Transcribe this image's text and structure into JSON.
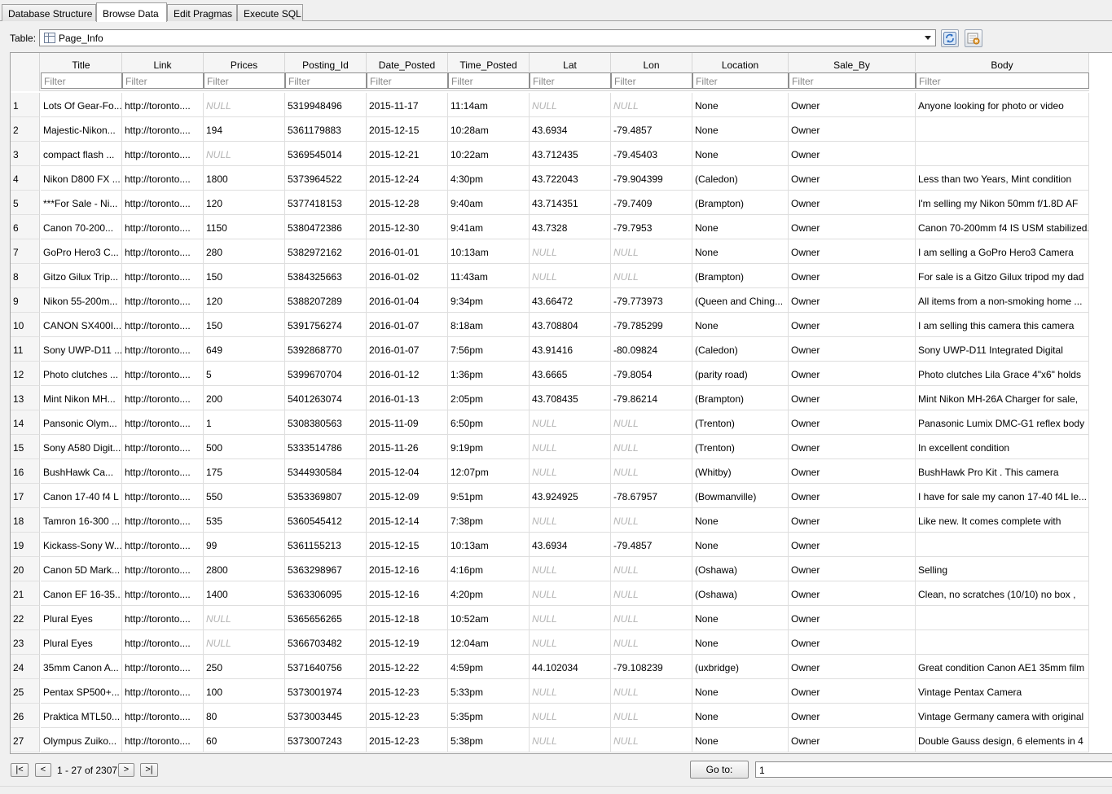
{
  "tabs": [
    {
      "label": "Database Structure"
    },
    {
      "label": "Browse Data",
      "active": true
    },
    {
      "label": "Edit Pragmas"
    },
    {
      "label": "Execute SQL"
    }
  ],
  "table_selector": {
    "label": "Table:",
    "value": "Page_Info"
  },
  "columns": [
    "Title",
    "Link",
    "Prices",
    "Posting_Id",
    "Date_Posted",
    "Time_Posted",
    "Lat",
    "Lon",
    "Location",
    "Sale_By",
    "Body"
  ],
  "filter_placeholder": "Filter",
  "rows": [
    [
      "1",
      "Lots Of Gear-Fo...",
      "http://toronto....",
      "NULL",
      "5319948496",
      "2015-11-17",
      "11:14am",
      "NULL",
      "NULL",
      "None",
      "Owner",
      "Anyone looking for photo or video"
    ],
    [
      "2",
      "Majestic-Nikon...",
      "http://toronto....",
      "194",
      "5361179883",
      "2015-12-15",
      "10:28am",
      "43.6934",
      "-79.4857",
      "None",
      "Owner",
      ""
    ],
    [
      "3",
      "compact flash ...",
      "http://toronto....",
      "NULL",
      "5369545014",
      "2015-12-21",
      "10:22am",
      "43.712435",
      "-79.45403",
      "None",
      "Owner",
      ""
    ],
    [
      "4",
      "Nikon D800 FX ...",
      "http://toronto....",
      "1800",
      "5373964522",
      "2015-12-24",
      "4:30pm",
      "43.722043",
      "-79.904399",
      " (Caledon)",
      "Owner",
      "Less than two Years, Mint condition"
    ],
    [
      "5",
      "***For Sale - Ni...",
      "http://toronto....",
      "120",
      "5377418153",
      "2015-12-28",
      "9:40am",
      "43.714351",
      "-79.7409",
      " (Brampton)",
      "Owner",
      "I'm selling my Nikon 50mm f/1.8D AF"
    ],
    [
      "6",
      "Canon 70-200...",
      "http://toronto....",
      "1150",
      "5380472386",
      "2015-12-30",
      "9:41am",
      "43.7328",
      "-79.7953",
      "None",
      "Owner",
      "Canon 70-200mm f4 IS USM stabilized."
    ],
    [
      "7",
      "GoPro Hero3 C...",
      "http://toronto....",
      "280",
      "5382972162",
      "2016-01-01",
      "10:13am",
      "NULL",
      "NULL",
      "None",
      "Owner",
      "I am selling a GoPro Hero3 Camera"
    ],
    [
      "8",
      "Gitzo Gilux Trip...",
      "http://toronto....",
      "150",
      "5384325663",
      "2016-01-02",
      "11:43am",
      "NULL",
      "NULL",
      " (Brampton)",
      "Owner",
      "For sale is a Gitzo Gilux tripod my dad"
    ],
    [
      "9",
      "Nikon 55-200m...",
      "http://toronto....",
      "120",
      "5388207289",
      "2016-01-04",
      "9:34pm",
      "43.66472",
      "-79.773973",
      " (Queen and Ching...",
      "Owner",
      "All items from a non-smoking home ..."
    ],
    [
      "10",
      "CANON SX400I...",
      "http://toronto....",
      "150",
      "5391756274",
      "2016-01-07",
      "8:18am",
      "43.708804",
      "-79.785299",
      "None",
      "Owner",
      "I am selling this camera this camera"
    ],
    [
      "11",
      "Sony UWP-D11 ...",
      "http://toronto....",
      "649",
      "5392868770",
      "2016-01-07",
      "7:56pm",
      "43.91416",
      "-80.09824",
      " (Caledon)",
      "Owner",
      "Sony UWP-D11 Integrated Digital"
    ],
    [
      "12",
      "Photo clutches ...",
      "http://toronto....",
      "5",
      "5399670704",
      "2016-01-12",
      "1:36pm",
      "43.6665",
      "-79.8054",
      " (parity road)",
      "Owner",
      "Photo clutches Lila Grace 4\"x6\" holds"
    ],
    [
      "13",
      "Mint Nikon MH...",
      "http://toronto....",
      "200",
      "5401263074",
      "2016-01-13",
      "2:05pm",
      "43.708435",
      "-79.86214",
      " (Brampton)",
      "Owner",
      "Mint Nikon MH-26A Charger for sale,"
    ],
    [
      "14",
      "Pansonic Olym...",
      "http://toronto....",
      "1",
      "5308380563",
      "2015-11-09",
      "6:50pm",
      "NULL",
      "NULL",
      " (Trenton)",
      "Owner",
      "Panasonic Lumix DMC-G1 reflex body"
    ],
    [
      "15",
      "Sony A580 Digit...",
      "http://toronto....",
      "500",
      "5333514786",
      "2015-11-26",
      "9:19pm",
      "NULL",
      "NULL",
      " (Trenton)",
      "Owner",
      "In excellent condition"
    ],
    [
      "16",
      "BushHawk Ca...",
      "http://toronto....",
      "175",
      "5344930584",
      "2015-12-04",
      "12:07pm",
      "NULL",
      "NULL",
      " (Whitby)",
      "Owner",
      "BushHawk Pro Kit . This camera"
    ],
    [
      "17",
      "Canon 17-40 f4 L",
      "http://toronto....",
      "550",
      "5353369807",
      "2015-12-09",
      "9:51pm",
      "43.924925",
      "-78.67957",
      " (Bowmanville)",
      "Owner",
      "I have for sale my canon 17-40 f4L le..."
    ],
    [
      "18",
      "Tamron 16-300 ...",
      "http://toronto....",
      "535",
      "5360545412",
      "2015-12-14",
      "7:38pm",
      "NULL",
      "NULL",
      "None",
      "Owner",
      "Like new. It comes complete with"
    ],
    [
      "19",
      "Kickass-Sony W...",
      "http://toronto....",
      "99",
      "5361155213",
      "2015-12-15",
      "10:13am",
      "43.6934",
      "-79.4857",
      "None",
      "Owner",
      ""
    ],
    [
      "20",
      "Canon 5D Mark...",
      "http://toronto....",
      "2800",
      "5363298967",
      "2015-12-16",
      "4:16pm",
      "NULL",
      "NULL",
      " (Oshawa)",
      "Owner",
      "Selling"
    ],
    [
      "21",
      "Canon EF 16-35...",
      "http://toronto....",
      "1400",
      "5363306095",
      "2015-12-16",
      "4:20pm",
      "NULL",
      "NULL",
      " (Oshawa)",
      "Owner",
      "Clean, no scratches (10/10) no box ,"
    ],
    [
      "22",
      "Plural Eyes",
      "http://toronto....",
      "NULL",
      "5365656265",
      "2015-12-18",
      "10:52am",
      "NULL",
      "NULL",
      "None",
      "Owner",
      ""
    ],
    [
      "23",
      "Plural Eyes",
      "http://toronto....",
      "NULL",
      "5366703482",
      "2015-12-19",
      "12:04am",
      "NULL",
      "NULL",
      "None",
      "Owner",
      ""
    ],
    [
      "24",
      "35mm Canon A...",
      "http://toronto....",
      "250",
      "5371640756",
      "2015-12-22",
      "4:59pm",
      "44.102034",
      "-79.108239",
      " (uxbridge)",
      "Owner",
      "Great condition Canon AE1 35mm film"
    ],
    [
      "25",
      "Pentax SP500+...",
      "http://toronto....",
      "100",
      "5373001974",
      "2015-12-23",
      "5:33pm",
      "NULL",
      "NULL",
      "None",
      "Owner",
      "Vintage Pentax Camera"
    ],
    [
      "26",
      "Praktica MTL50...",
      "http://toronto....",
      "80",
      "5373003445",
      "2015-12-23",
      "5:35pm",
      "NULL",
      "NULL",
      "None",
      "Owner",
      "Vintage Germany camera with original"
    ],
    [
      "27",
      "Olympus Zuiko...",
      "http://toronto....",
      "60",
      "5373007243",
      "2015-12-23",
      "5:38pm",
      "NULL",
      "NULL",
      "None",
      "Owner",
      "Double Gauss design, 6 elements in 4"
    ]
  ],
  "navigation": {
    "first_label": "|<",
    "prev_label": "<",
    "status": "1 - 27 of 2307",
    "next_label": ">",
    "last_label": ">|",
    "goto_label": "Go to:",
    "goto_value": "1"
  }
}
